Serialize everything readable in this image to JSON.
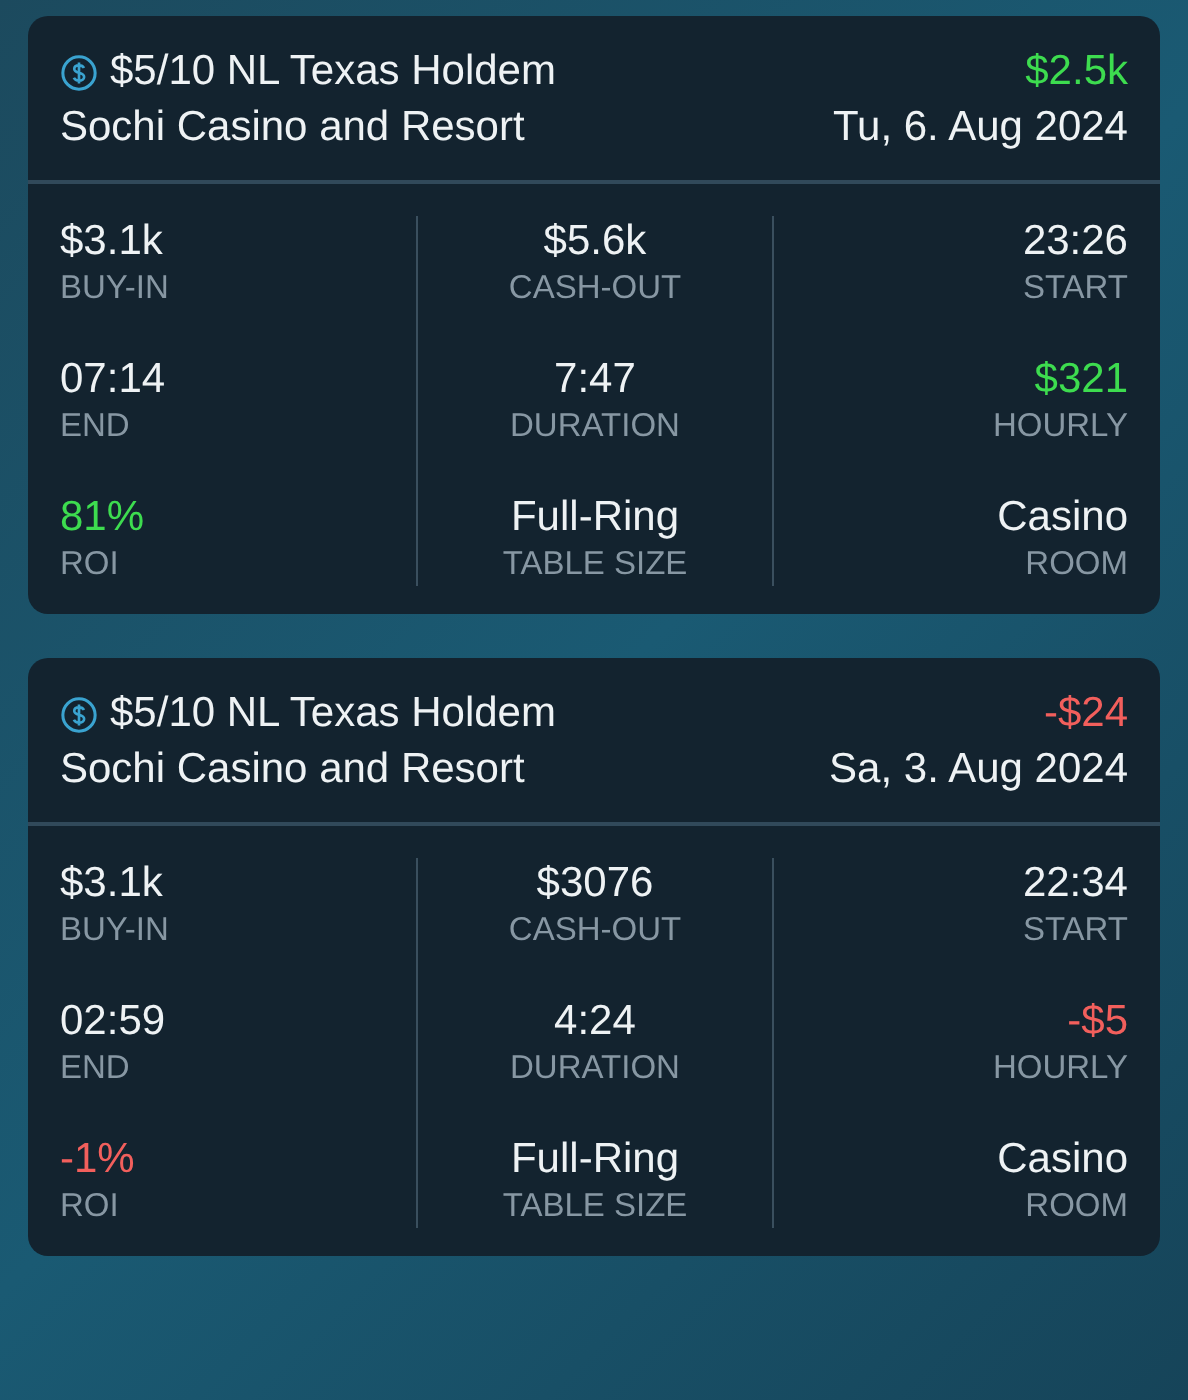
{
  "sessions": [
    {
      "game": "$5/10 NL Texas Holdem",
      "venue": "Sochi Casino and Resort",
      "result": {
        "text": "$2.5k",
        "color": "#3ddc4f"
      },
      "date": "Tu, 6. Aug 2024",
      "stats": [
        {
          "value": "$3.1k",
          "label": "BUY-IN",
          "color": "#eef2f4"
        },
        {
          "value": "$5.6k",
          "label": "CASH-OUT",
          "color": "#eef2f4"
        },
        {
          "value": "23:26",
          "label": "START",
          "color": "#eef2f4"
        },
        {
          "value": "07:14",
          "label": "END",
          "color": "#eef2f4"
        },
        {
          "value": "7:47",
          "label": "DURATION",
          "color": "#eef2f4"
        },
        {
          "value": "$321",
          "label": "HOURLY",
          "color": "#3ddc4f"
        },
        {
          "value": "81%",
          "label": "ROI",
          "color": "#3ddc4f"
        },
        {
          "value": "Full-Ring",
          "label": "TABLE SIZE",
          "color": "#eef2f4"
        },
        {
          "value": "Casino",
          "label": "ROOM",
          "color": "#eef2f4"
        }
      ]
    },
    {
      "game": "$5/10 NL Texas Holdem",
      "venue": "Sochi Casino and Resort",
      "result": {
        "text": "-$24",
        "color": "#f25f5c"
      },
      "date": "Sa, 3. Aug 2024",
      "stats": [
        {
          "value": "$3.1k",
          "label": "BUY-IN",
          "color": "#eef2f4"
        },
        {
          "value": "$3076",
          "label": "CASH-OUT",
          "color": "#eef2f4"
        },
        {
          "value": "22:34",
          "label": "START",
          "color": "#eef2f4"
        },
        {
          "value": "02:59",
          "label": "END",
          "color": "#eef2f4"
        },
        {
          "value": "4:24",
          "label": "DURATION",
          "color": "#eef2f4"
        },
        {
          "value": "-$5",
          "label": "HOURLY",
          "color": "#f25f5c"
        },
        {
          "value": "-1%",
          "label": "ROI",
          "color": "#f25f5c"
        },
        {
          "value": "Full-Ring",
          "label": "TABLE SIZE",
          "color": "#eef2f4"
        },
        {
          "value": "Casino",
          "label": "ROOM",
          "color": "#eef2f4"
        }
      ]
    }
  ]
}
